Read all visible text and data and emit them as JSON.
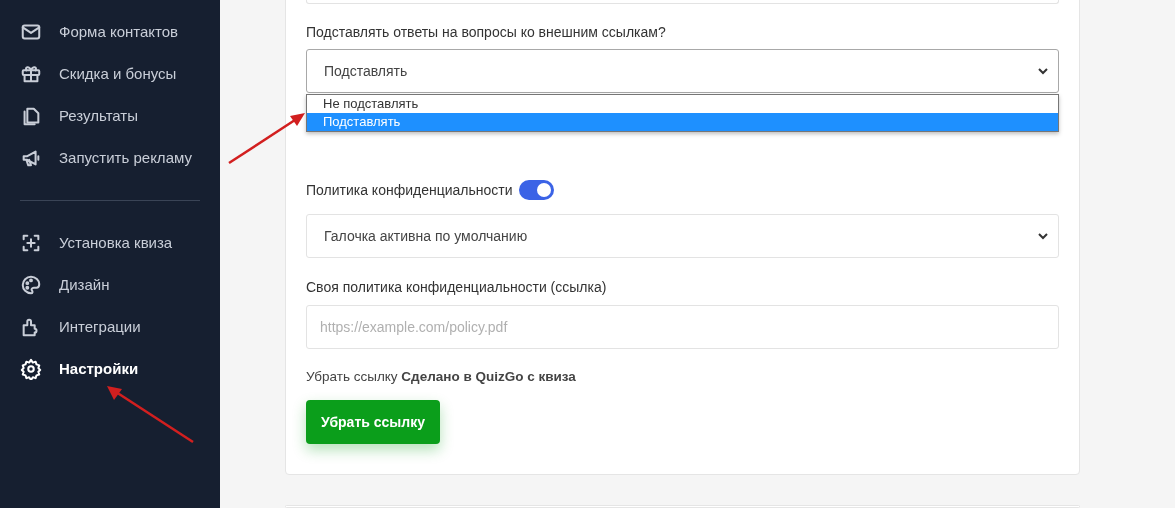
{
  "sidebar": {
    "groups": [
      {
        "items": [
          {
            "label": "Форма контактов",
            "selected": false
          },
          {
            "label": "Скидка и бонусы",
            "selected": false
          },
          {
            "label": "Результаты",
            "selected": false
          },
          {
            "label": "Запустить рекламу",
            "selected": false
          }
        ]
      },
      {
        "items": [
          {
            "label": "Установка квиза",
            "selected": false
          },
          {
            "label": "Дизайн",
            "selected": false
          },
          {
            "label": "Интеграции",
            "selected": false
          },
          {
            "label": "Настройки",
            "selected": true
          }
        ]
      }
    ]
  },
  "settings": {
    "answers_select": {
      "label": "Подставлять ответы на вопросы ко внешним ссылкам?",
      "value": "Подставлять",
      "expanded": true,
      "options": [
        {
          "label": "Не подставлять",
          "selected": false
        },
        {
          "label": "Подставлять",
          "selected": true
        }
      ]
    },
    "privacy": {
      "label": "Политика конфиденциальности",
      "on": true
    },
    "privacy_select": {
      "value": "Галочка активна по умолчанию"
    },
    "policy_link": {
      "label": "Своя политика конфиденциальности (ссылка)",
      "placeholder": "https://example.com/policy.pdf"
    },
    "remove_link": {
      "text": "Убрать ссылку **Сделано в QuizGo с квиза**",
      "button": "Убрать ссылку"
    }
  }
}
